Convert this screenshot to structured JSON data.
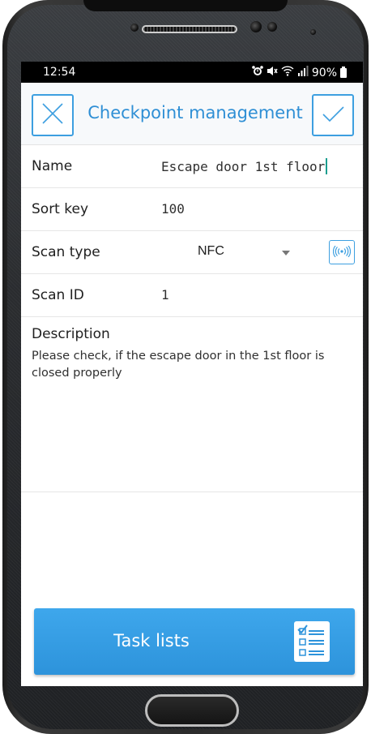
{
  "status_bar": {
    "time": "12:54",
    "battery": "90%",
    "icons": [
      "alarm-icon",
      "mute-icon",
      "wifi-icon",
      "signal-icon",
      "battery-icon"
    ]
  },
  "header": {
    "title": "Checkpoint management",
    "cancel_icon": "close-icon",
    "confirm_icon": "check-icon",
    "accent_color": "#3d9fe0"
  },
  "form": {
    "name": {
      "label": "Name",
      "value": "Escape door 1st floor"
    },
    "sort_key": {
      "label": "Sort key",
      "value": "100"
    },
    "scan_type": {
      "label": "Scan type",
      "value": "NFC",
      "icon": "nfc-icon"
    },
    "scan_id": {
      "label": "Scan ID",
      "value": "1"
    },
    "description": {
      "label": "Description",
      "value": "Please check, if the escape door in the 1st floor is closed properly"
    }
  },
  "task_button": {
    "label": "Task lists",
    "icon": "checklist-icon",
    "color": "#3ea7ec"
  }
}
